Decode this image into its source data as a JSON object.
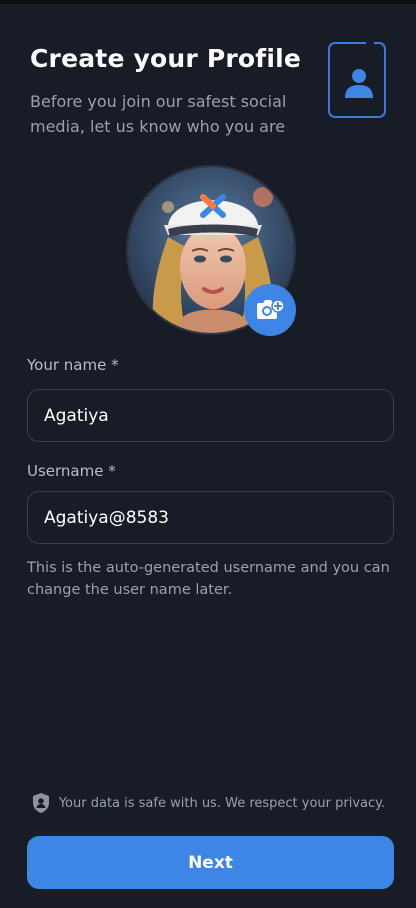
{
  "header": {
    "title": "Create your Profile",
    "subtitle": "Before you join our safest social media, let us know who you are"
  },
  "profile_icon": "user-profile-card-icon",
  "avatar": {
    "alt": "Profile photo",
    "camera_icon": "camera-add-icon"
  },
  "form": {
    "name_label": "Your name *",
    "name_value": "Agatiya",
    "username_label": "Username *",
    "username_value": "Agatiya@8583",
    "username_help": "This is the auto-generated username and you can change the user name later."
  },
  "footer": {
    "privacy_icon": "shield-user-icon",
    "privacy_text": "Your data is safe with us. We respect your privacy.",
    "next_label": "Next"
  },
  "colors": {
    "background": "#181c27",
    "accent": "#3d86e6"
  }
}
